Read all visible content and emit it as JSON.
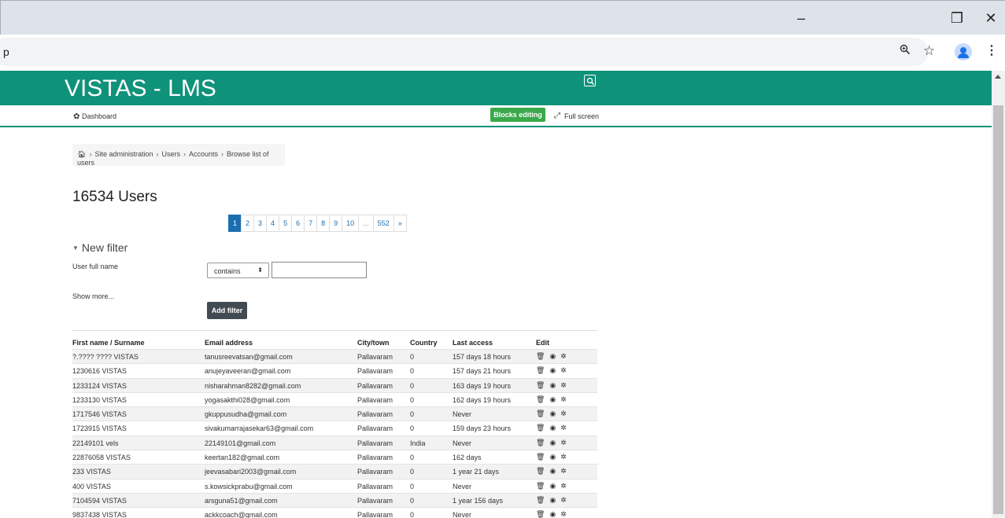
{
  "browser": {
    "url_fragment": "p",
    "controls": {
      "minimize": "–",
      "restore": "❐",
      "close": "✕"
    },
    "icons": [
      "zoom-icon",
      "star-icon",
      "profile-avatar",
      "menu-icon"
    ]
  },
  "site": {
    "title": "VISTAS - LMS",
    "brand_color": "#0f927a"
  },
  "nav": {
    "dashboard": "Dashboard",
    "blocks_editing": "Blocks editing on",
    "full_screen": "Full screen"
  },
  "breadcrumb": [
    "Site administration",
    "Users",
    "Accounts",
    "Browse list of users"
  ],
  "page_title": "16534 Users",
  "pagination": [
    "1",
    "2",
    "3",
    "4",
    "5",
    "6",
    "7",
    "8",
    "9",
    "10",
    "...",
    "552",
    "»"
  ],
  "pagination_active": "1",
  "filter": {
    "toggle": "New filter",
    "field_label": "User full name",
    "operator": "contains",
    "value": "",
    "show_more": "Show more...",
    "add_button": "Add filter"
  },
  "table": {
    "headers": [
      "First name / Surname",
      "Email address",
      "City/town",
      "Country",
      "Last access",
      "Edit"
    ],
    "rows": [
      [
        "?.???? ???? VISTAS",
        "tanusreevatsan@gmail.com",
        "Pallavaram",
        "0",
        "157 days 18 hours"
      ],
      [
        "1230616 VISTAS",
        "anujeyaveeran@gmail.com",
        "Pallavaram",
        "0",
        "157 days 21 hours"
      ],
      [
        "1233124 VISTAS",
        "nisharahman8282@gmail.com",
        "Pallavaram",
        "0",
        "163 days 19 hours"
      ],
      [
        "1233130 VISTAS",
        "yogasakthi028@gmail.com",
        "Pallavaram",
        "0",
        "162 days 19 hours"
      ],
      [
        "1717546 VISTAS",
        "gkuppusudha@gmail.com",
        "Pallavaram",
        "0",
        "Never"
      ],
      [
        "1723915 VISTAS",
        "sivakumarrajasekar63@gmail.com",
        "Pallavaram",
        "0",
        "159 days 23 hours"
      ],
      [
        "22149101 vels",
        "22149101@gmail.com",
        "Pallavaram",
        "India",
        "Never"
      ],
      [
        "22876058 VISTAS",
        "keertan182@gmail.com",
        "Pallavaram",
        "0",
        "162 days"
      ],
      [
        "233 VISTAS",
        "jeevasabari2003@gmail.com",
        "Pallavaram",
        "0",
        "1 year 21 days"
      ],
      [
        "400 VISTAS",
        "s.kowsickprabu@gmail.com",
        "Pallavaram",
        "0",
        "Never"
      ],
      [
        "7104594 VISTAS",
        "arsguna51@gmail.com",
        "Pallavaram",
        "0",
        "1 year 156 days"
      ],
      [
        "9837438 VISTAS",
        "ackkcoach@gmail.com",
        "Pallavaram",
        "0",
        "Never"
      ]
    ],
    "edit_icons": [
      "trash-icon",
      "eye-icon",
      "gear-icon"
    ]
  }
}
